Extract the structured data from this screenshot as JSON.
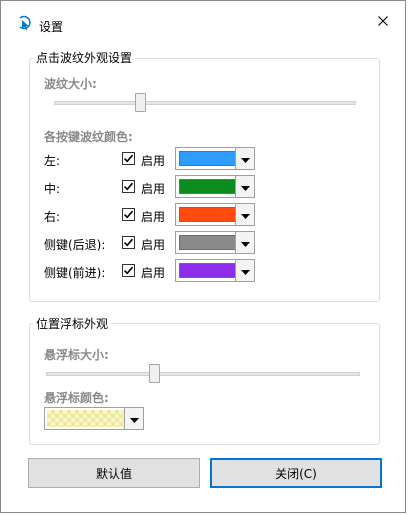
{
  "window": {
    "title": "设置"
  },
  "ripple_group": {
    "title": "点击波纹外观设置",
    "size_label": "波纹大小:",
    "size_slider_value": 0.28,
    "colors_label": "各按键波纹颜色:",
    "rows": [
      {
        "label": "左:",
        "checked": true,
        "enable_label": "启用",
        "color": "#2c9cff"
      },
      {
        "label": "中:",
        "checked": true,
        "enable_label": "启用",
        "color": "#0c8c1a"
      },
      {
        "label": "右:",
        "checked": true,
        "enable_label": "启用",
        "color": "#ff4a10"
      },
      {
        "label": "侧键(后退):",
        "checked": true,
        "enable_label": "启用",
        "color": "#8a8a8a"
      },
      {
        "label": "侧键(前进):",
        "checked": true,
        "enable_label": "启用",
        "color": "#8c2ee8"
      }
    ]
  },
  "hover_group": {
    "title": "位置浮标外观",
    "size_label": "悬浮标大小:",
    "size_slider_value": 0.34,
    "color_label": "悬浮标颜色:",
    "color": "#fbf7c4"
  },
  "buttons": {
    "default_label": "默认值",
    "close_label": "关闭(C)"
  },
  "icons": {
    "app": "ripple-cursor-icon",
    "close": "close-icon",
    "checkbox": "checkmark-icon",
    "dropdown": "chevron-down-icon"
  },
  "colors": {
    "accent": "#0078d7"
  }
}
